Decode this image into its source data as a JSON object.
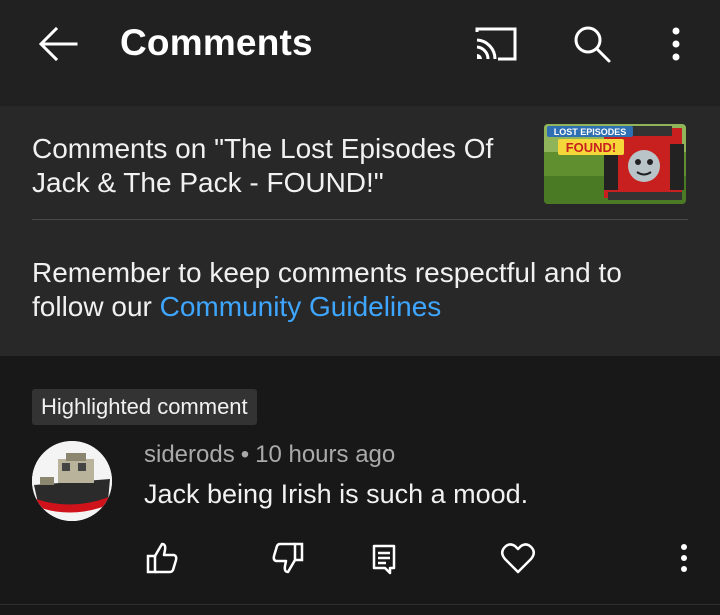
{
  "topbar": {
    "title": "Comments",
    "icons": [
      "back-arrow-icon",
      "cast-icon",
      "search-icon",
      "more-vert-icon"
    ]
  },
  "video": {
    "title": "Comments on \"The Lost Episodes Of Jack & The Pack - FOUND!\"",
    "thumbnail": {
      "line1": "LOST EPISODES",
      "line2": "FOUND!"
    }
  },
  "guidelines": {
    "text": "Remember to keep comments respectful and to follow our ",
    "link": "Community Guidelines"
  },
  "comment": {
    "badge": "Highlighted comment",
    "author": "siderods",
    "separator": "•",
    "time": "10 hours ago",
    "text": "Jack being Irish is such a mood.",
    "actions": [
      "like-icon",
      "dislike-icon",
      "reply-icon",
      "heart-icon",
      "more-vert-icon"
    ]
  },
  "colors": {
    "background": "#181818",
    "topbar": "#212121",
    "panel": "#282828",
    "link": "#3ea6ff",
    "secondary_text": "#aaaaaa"
  }
}
